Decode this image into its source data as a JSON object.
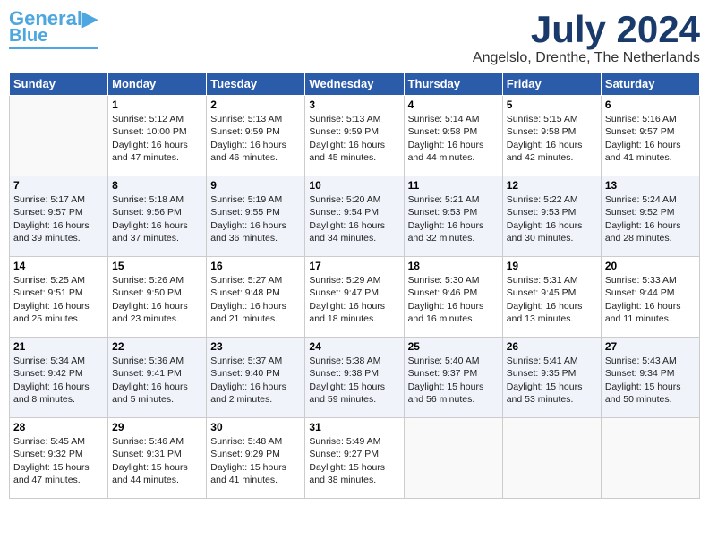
{
  "header": {
    "logo_line1": "General",
    "logo_line2": "Blue",
    "month": "July 2024",
    "location": "Angelslo, Drenthe, The Netherlands"
  },
  "days_of_week": [
    "Sunday",
    "Monday",
    "Tuesday",
    "Wednesday",
    "Thursday",
    "Friday",
    "Saturday"
  ],
  "weeks": [
    [
      {
        "day": "",
        "content": ""
      },
      {
        "day": "1",
        "content": "Sunrise: 5:12 AM\nSunset: 10:00 PM\nDaylight: 16 hours\nand 47 minutes."
      },
      {
        "day": "2",
        "content": "Sunrise: 5:13 AM\nSunset: 9:59 PM\nDaylight: 16 hours\nand 46 minutes."
      },
      {
        "day": "3",
        "content": "Sunrise: 5:13 AM\nSunset: 9:59 PM\nDaylight: 16 hours\nand 45 minutes."
      },
      {
        "day": "4",
        "content": "Sunrise: 5:14 AM\nSunset: 9:58 PM\nDaylight: 16 hours\nand 44 minutes."
      },
      {
        "day": "5",
        "content": "Sunrise: 5:15 AM\nSunset: 9:58 PM\nDaylight: 16 hours\nand 42 minutes."
      },
      {
        "day": "6",
        "content": "Sunrise: 5:16 AM\nSunset: 9:57 PM\nDaylight: 16 hours\nand 41 minutes."
      }
    ],
    [
      {
        "day": "7",
        "content": "Sunrise: 5:17 AM\nSunset: 9:57 PM\nDaylight: 16 hours\nand 39 minutes."
      },
      {
        "day": "8",
        "content": "Sunrise: 5:18 AM\nSunset: 9:56 PM\nDaylight: 16 hours\nand 37 minutes."
      },
      {
        "day": "9",
        "content": "Sunrise: 5:19 AM\nSunset: 9:55 PM\nDaylight: 16 hours\nand 36 minutes."
      },
      {
        "day": "10",
        "content": "Sunrise: 5:20 AM\nSunset: 9:54 PM\nDaylight: 16 hours\nand 34 minutes."
      },
      {
        "day": "11",
        "content": "Sunrise: 5:21 AM\nSunset: 9:53 PM\nDaylight: 16 hours\nand 32 minutes."
      },
      {
        "day": "12",
        "content": "Sunrise: 5:22 AM\nSunset: 9:53 PM\nDaylight: 16 hours\nand 30 minutes."
      },
      {
        "day": "13",
        "content": "Sunrise: 5:24 AM\nSunset: 9:52 PM\nDaylight: 16 hours\nand 28 minutes."
      }
    ],
    [
      {
        "day": "14",
        "content": "Sunrise: 5:25 AM\nSunset: 9:51 PM\nDaylight: 16 hours\nand 25 minutes."
      },
      {
        "day": "15",
        "content": "Sunrise: 5:26 AM\nSunset: 9:50 PM\nDaylight: 16 hours\nand 23 minutes."
      },
      {
        "day": "16",
        "content": "Sunrise: 5:27 AM\nSunset: 9:48 PM\nDaylight: 16 hours\nand 21 minutes."
      },
      {
        "day": "17",
        "content": "Sunrise: 5:29 AM\nSunset: 9:47 PM\nDaylight: 16 hours\nand 18 minutes."
      },
      {
        "day": "18",
        "content": "Sunrise: 5:30 AM\nSunset: 9:46 PM\nDaylight: 16 hours\nand 16 minutes."
      },
      {
        "day": "19",
        "content": "Sunrise: 5:31 AM\nSunset: 9:45 PM\nDaylight: 16 hours\nand 13 minutes."
      },
      {
        "day": "20",
        "content": "Sunrise: 5:33 AM\nSunset: 9:44 PM\nDaylight: 16 hours\nand 11 minutes."
      }
    ],
    [
      {
        "day": "21",
        "content": "Sunrise: 5:34 AM\nSunset: 9:42 PM\nDaylight: 16 hours\nand 8 minutes."
      },
      {
        "day": "22",
        "content": "Sunrise: 5:36 AM\nSunset: 9:41 PM\nDaylight: 16 hours\nand 5 minutes."
      },
      {
        "day": "23",
        "content": "Sunrise: 5:37 AM\nSunset: 9:40 PM\nDaylight: 16 hours\nand 2 minutes."
      },
      {
        "day": "24",
        "content": "Sunrise: 5:38 AM\nSunset: 9:38 PM\nDaylight: 15 hours\nand 59 minutes."
      },
      {
        "day": "25",
        "content": "Sunrise: 5:40 AM\nSunset: 9:37 PM\nDaylight: 15 hours\nand 56 minutes."
      },
      {
        "day": "26",
        "content": "Sunrise: 5:41 AM\nSunset: 9:35 PM\nDaylight: 15 hours\nand 53 minutes."
      },
      {
        "day": "27",
        "content": "Sunrise: 5:43 AM\nSunset: 9:34 PM\nDaylight: 15 hours\nand 50 minutes."
      }
    ],
    [
      {
        "day": "28",
        "content": "Sunrise: 5:45 AM\nSunset: 9:32 PM\nDaylight: 15 hours\nand 47 minutes."
      },
      {
        "day": "29",
        "content": "Sunrise: 5:46 AM\nSunset: 9:31 PM\nDaylight: 15 hours\nand 44 minutes."
      },
      {
        "day": "30",
        "content": "Sunrise: 5:48 AM\nSunset: 9:29 PM\nDaylight: 15 hours\nand 41 minutes."
      },
      {
        "day": "31",
        "content": "Sunrise: 5:49 AM\nSunset: 9:27 PM\nDaylight: 15 hours\nand 38 minutes."
      },
      {
        "day": "",
        "content": ""
      },
      {
        "day": "",
        "content": ""
      },
      {
        "day": "",
        "content": ""
      }
    ]
  ]
}
